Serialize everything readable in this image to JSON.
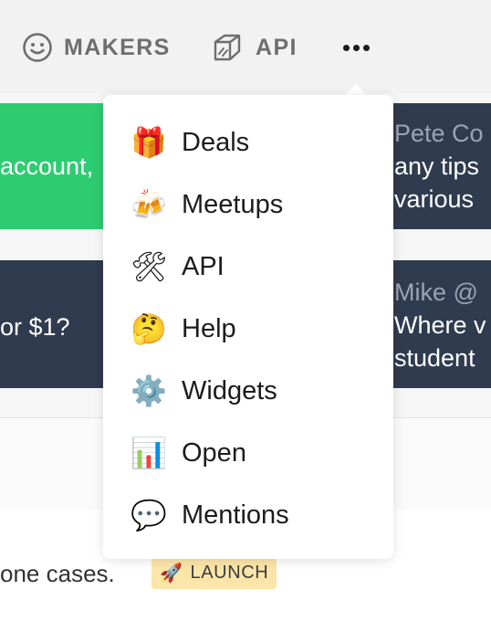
{
  "nav": {
    "makers_label": "MAKERS",
    "api_label": "API"
  },
  "cards": {
    "green_left": "account,",
    "right_top_author": "Pete Co",
    "right_top_line1": "any tips",
    "right_top_line2": "various",
    "dark_left": "or $1?",
    "right_bottom_author": "Mike @",
    "right_bottom_line1": "Where v",
    "right_bottom_line2": "student"
  },
  "bottom": {
    "text": "one cases.",
    "badge_icon": "🚀",
    "badge_label": "LAUNCH"
  },
  "menu": {
    "items": [
      {
        "icon": "🎁",
        "icon_name": "gift-icon",
        "label": "Deals"
      },
      {
        "icon": "🍻",
        "icon_name": "beer-mugs-icon",
        "label": "Meetups"
      },
      {
        "icon": "🛠",
        "icon_name": "tools-icon",
        "label": "API"
      },
      {
        "icon": "🤔",
        "icon_name": "thinking-face-icon",
        "label": "Help"
      },
      {
        "icon": "⚙️",
        "icon_name": "gear-icon",
        "label": "Widgets"
      },
      {
        "icon": "📊",
        "icon_name": "bar-chart-icon",
        "label": "Open"
      },
      {
        "icon": "💬",
        "icon_name": "speech-bubble-icon",
        "label": "Mentions"
      }
    ]
  },
  "colors": {
    "green": "#2ecc71",
    "navy": "#2f3b4e",
    "badge": "#fce5a8"
  }
}
